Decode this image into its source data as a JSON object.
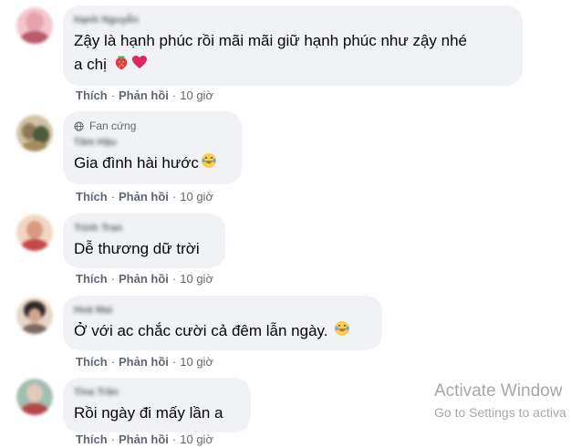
{
  "comments": [
    {
      "author": "Hạnh Nguyễn",
      "text_line1": "Zậy là hạnh phúc rồi mãi mãi giữ hạnh phúc như zậy nhé",
      "text_line2": "a chị",
      "like": "Thích",
      "reply": "Phản hồi",
      "time": "10 giờ",
      "avatar_colors": [
        "#f3c6cf",
        "#e8a3b1",
        "#b85a6a"
      ]
    },
    {
      "badge": "Fan cứng",
      "author": "Tâm Hậu",
      "text": "Gia đình hài hước",
      "like": "Thích",
      "reply": "Phản hồi",
      "time": "10 giờ",
      "avatar_colors": [
        "#cfc3a7",
        "#8e7a55",
        "#4d5a3a"
      ]
    },
    {
      "author": "Trịnh Tran",
      "text": "Dễ thương dữ trời",
      "like": "Thích",
      "reply": "Phản hồi",
      "time": "10 giờ",
      "avatar_colors": [
        "#f1d6c4",
        "#d99a7e",
        "#c4474a"
      ]
    },
    {
      "author": "Hoà Mai",
      "text": "Ở với ac chắc cười cả đêm lẫn ngày.",
      "like": "Thích",
      "reply": "Phản hồi",
      "time": "10 giờ",
      "avatar_colors": [
        "#e5d6c8",
        "#7e6a5d",
        "#2f2a2a"
      ]
    },
    {
      "author": "Tina Trần",
      "text": "Rồi ngày đi mấy lần a",
      "like": "Thích",
      "reply": "Phản hồi",
      "time": "10 giờ",
      "avatar_colors": [
        "#9fbfb0",
        "#b4454b",
        "#e3c9b8"
      ]
    }
  ],
  "watermark": {
    "line1": "Activate Window",
    "line2": "Go to Settings to activa"
  },
  "icons": {
    "globe": "globe-icon",
    "strawberry": "strawberry-emoji-icon",
    "heart": "red-heart-emoji-icon",
    "laugh": "tears-of-joy-emoji-icon"
  },
  "colors": {
    "bubble": "#f0f2f5",
    "meta_text": "#65676b",
    "heart": "#e0245e"
  }
}
